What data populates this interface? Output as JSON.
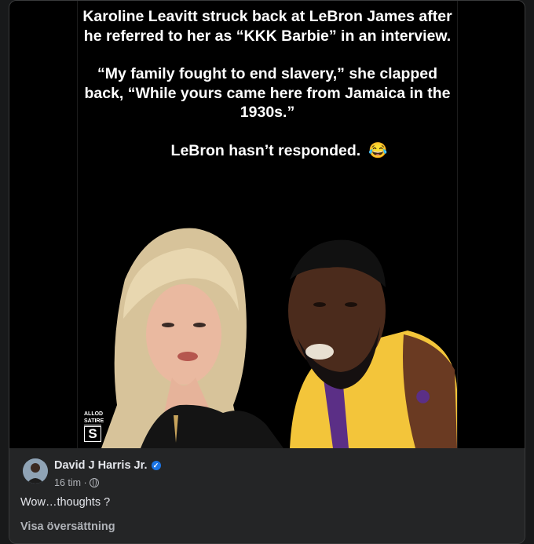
{
  "meme": {
    "paragraph1": "Karoline Leavitt struck back at LeBron James after he referred to her as “KKK Barbie” in an interview.",
    "paragraph2": "“My family fought to end slavery,” she clapped back, “While yours came here from Jamaica in the 1930s.”",
    "paragraph3": "LeBron hasn’t responded.",
    "emoji": "😂",
    "watermark_top": "ALLOD SATIRE",
    "watermark_letter": "S"
  },
  "post": {
    "author": "David J Harris Jr.",
    "verified_icon": "check",
    "time": "16 tim ·",
    "privacy_icon": "globe-icon",
    "text": "Wow…thoughts ?",
    "translate_link": "Visa översättning"
  },
  "colors": {
    "card_bg": "#242526",
    "text_primary": "#e4e6eb",
    "text_secondary": "#b0b3b8",
    "verified": "#1b74e4"
  }
}
